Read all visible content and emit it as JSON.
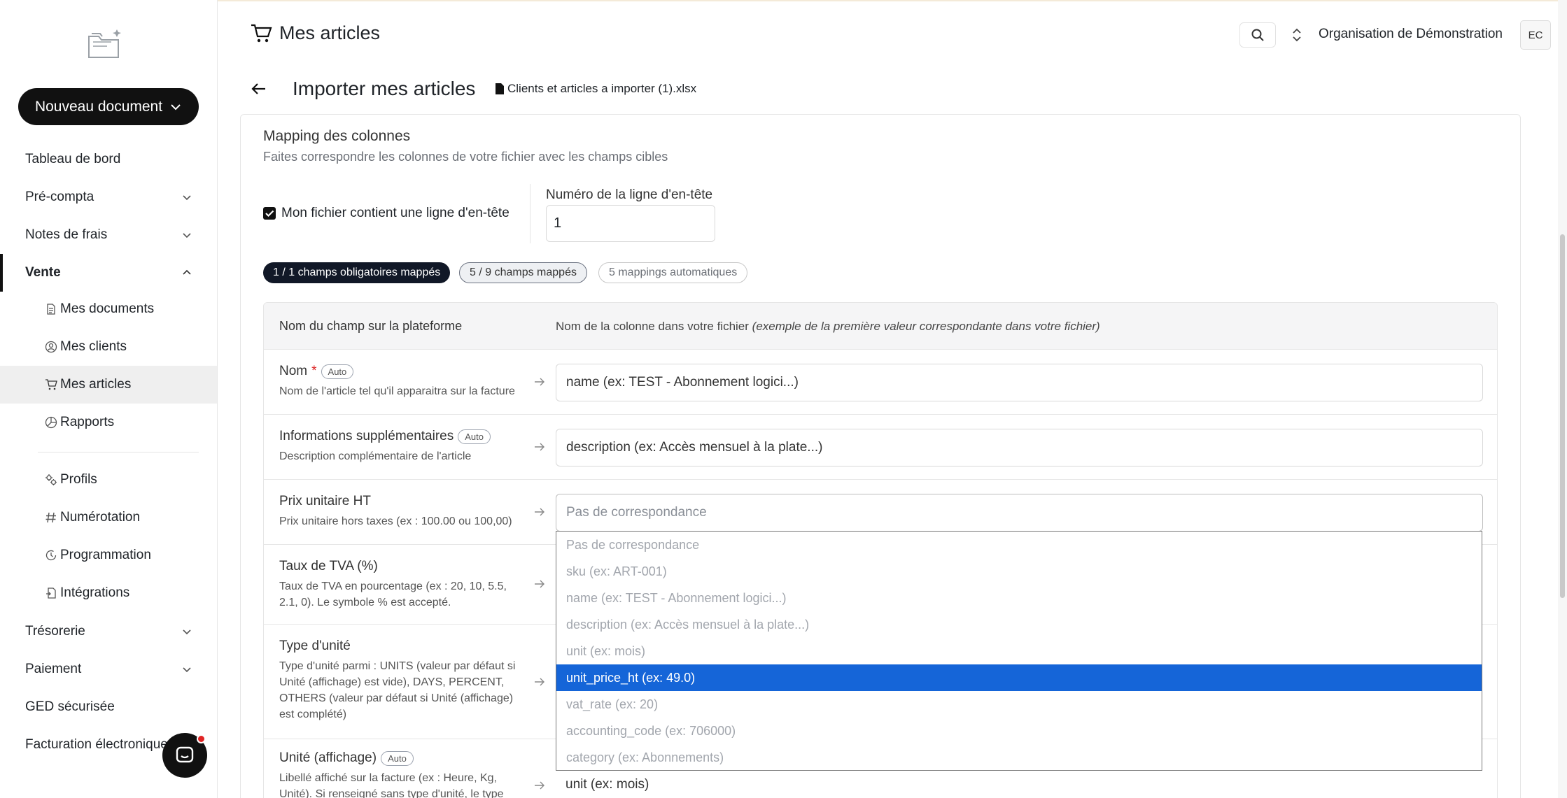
{
  "sidebar": {
    "new_document_label": "Nouveau document",
    "items": [
      {
        "label": "Tableau de bord"
      },
      {
        "label": "Pré-compta"
      },
      {
        "label": "Notes de frais"
      },
      {
        "label": "Vente"
      },
      {
        "label": "Mes documents"
      },
      {
        "label": "Mes clients"
      },
      {
        "label": "Mes articles"
      },
      {
        "label": "Rapports"
      },
      {
        "label": "Profils"
      },
      {
        "label": "Numérotation"
      },
      {
        "label": "Programmation"
      },
      {
        "label": "Intégrations"
      },
      {
        "label": "Trésorerie"
      },
      {
        "label": "Paiement"
      },
      {
        "label": "GED sécurisée"
      },
      {
        "label": "Facturation électronique"
      }
    ]
  },
  "header": {
    "title": "Mes articles",
    "org_name": "Organisation de Démonstration",
    "avatar_initials": "EC"
  },
  "import": {
    "title": "Importer mes articles",
    "file_name": "Clients et articles a importer (1).xlsx"
  },
  "mapping": {
    "title": "Mapping des colonnes",
    "subtitle": "Faites correspondre les colonnes de votre fichier avec les champs cibles",
    "header_checkbox_label": "Mon fichier contient une ligne d'en-tête",
    "header_checkbox_checked": true,
    "header_line_label": "Numéro de la ligne d'en-tête",
    "header_line_value": "1",
    "pills": {
      "required": "1 / 1 champs obligatoires mappés",
      "mapped": "5 / 9 champs mappés",
      "auto": "5 mappings automatiques"
    },
    "col_platform": "Nom du champ sur la plateforme",
    "col_file": "Nom de la colonne dans votre fichier",
    "col_file_hint": "(exemple de la première valeur correspondante dans votre fichier)",
    "auto_label": "Auto",
    "rows": [
      {
        "name": "Nom",
        "required_mark": "*",
        "desc": "Nom de l'article tel qu'il apparaitra sur la facture",
        "value": "name (ex: TEST - Abonnement logici...)"
      },
      {
        "name": "Informations supplémentaires",
        "desc": "Description complémentaire de l'article",
        "value": "description (ex: Accès mensuel à la plate...)"
      },
      {
        "name": "Prix unitaire HT",
        "desc": "Prix unitaire hors taxes (ex : 100.00 ou 100,00)",
        "value": "Pas de correspondance"
      },
      {
        "name": "Taux de TVA (%)",
        "desc": "Taux de TVA en pourcentage (ex : 20, 10, 5.5, 2.1, 0). Le symbole % est accepté.",
        "value": ""
      },
      {
        "name": "Type d'unité",
        "desc": "Type d'unité parmi : UNITS (valeur par défaut si Unité (affichage) est vide), DAYS, PERCENT, OTHERS (valeur par défaut si Unité (affichage) est complété)",
        "value": ""
      },
      {
        "name": "Unité (affichage)",
        "desc": "Libellé affiché sur la facture (ex : Heure, Kg, Unité). Si renseigné sans type d'unité, le type",
        "value": "unit (ex: mois)"
      }
    ],
    "dropdown_options": [
      "Pas de correspondance",
      "sku (ex: ART-001)",
      "name (ex: TEST - Abonnement logici...)",
      "description (ex: Accès mensuel à la plate...)",
      "unit (ex: mois)",
      "unit_price_ht (ex: 49.0)",
      "vat_rate (ex: 20)",
      "accounting_code (ex: 706000)",
      "category (ex: Abonnements)"
    ],
    "dropdown_selected": "unit_price_ht (ex: 49.0)"
  },
  "colors": {
    "accent_selected": "#1565d8",
    "dark": "#111111",
    "required": "#dc2626"
  }
}
